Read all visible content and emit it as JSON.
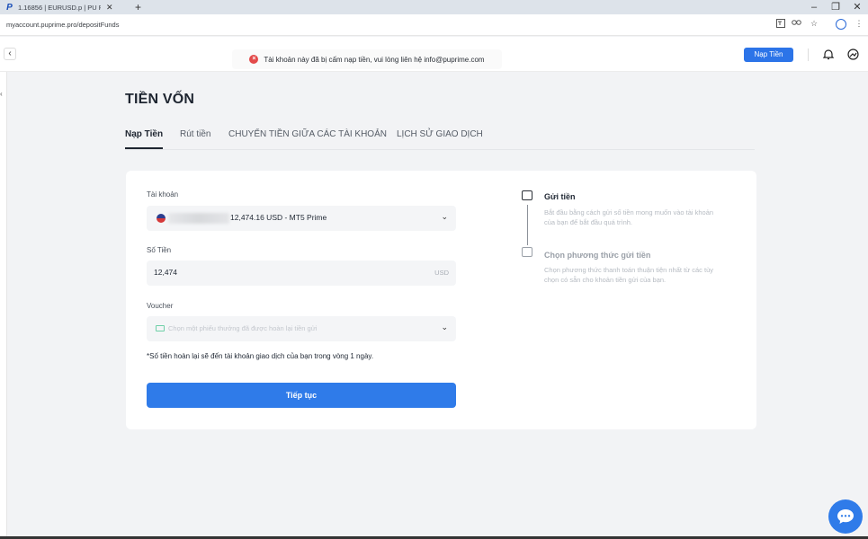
{
  "browser": {
    "tab_title": "1.16856 | EURUSD.p | PU Prime",
    "tab_close": "✕",
    "new_tab": "+",
    "url": "myaccount.puprime.pro/depositFunds",
    "win_min": "–",
    "win_restore": "❐",
    "win_close": "✕"
  },
  "header": {
    "back": "‹",
    "alert_text": "Tài khoản này đã bị cấm nạp tiền, vui lòng liên hệ info@puprime.com",
    "deposit_button": "Nạp Tiền"
  },
  "page": {
    "title": "TIỀN VỐN",
    "tabs": [
      {
        "label": "Nạp Tiền",
        "active": true
      },
      {
        "label": "Rút tiền",
        "active": false
      },
      {
        "label": "CHUYỂN TIỀN GIỮA CÁC TÀI KHOẢN",
        "active": false
      },
      {
        "label": "LỊCH SỬ GIAO DỊCH",
        "active": false
      }
    ]
  },
  "form": {
    "account_label": "Tài khoản",
    "account_value": "12,474.16 USD - MT5 Prime",
    "amount_label": "Số Tiền",
    "amount_value": "12,474",
    "amount_unit": "USD",
    "voucher_label": "Voucher",
    "voucher_placeholder": "Chọn một phiếu thưởng đã được hoàn lại tiền gửi",
    "note": "*Số tiền hoàn lại sẽ đến tài khoản giao dịch của bạn trong vòng 1 ngày.",
    "continue_button": "Tiếp tục"
  },
  "steps": [
    {
      "title": "Gửi tiền",
      "desc": "Bắt đầu bằng cách gửi số tiền mong muốn vào tài khoản của bạn để bắt đầu quá trình.",
      "active": true
    },
    {
      "title": "Chọn phương thức gửi tiền",
      "desc": "Chọn phương thức thanh toán thuận tiện nhất từ các tùy chọn có sẵn cho khoản tiền gửi của bạn.",
      "active": false
    }
  ],
  "icons": {
    "chevron": "⌄",
    "bell": "🔔",
    "chat": "💬"
  },
  "colors": {
    "primary": "#2f7be9",
    "alert": "#e34a4a"
  }
}
